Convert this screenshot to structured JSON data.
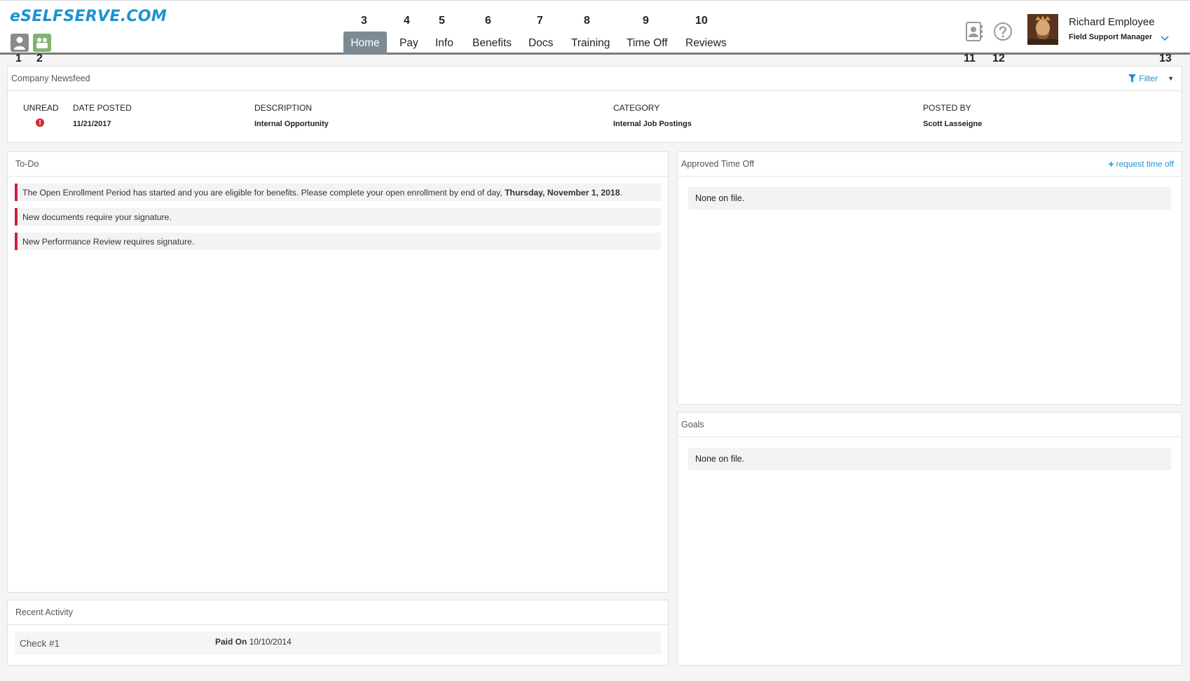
{
  "header": {
    "logo": "eSELFSERVE.COM",
    "nav": [
      {
        "label": "Home",
        "num": "3"
      },
      {
        "label": "Pay",
        "num": "4"
      },
      {
        "label": "Info",
        "num": "5"
      },
      {
        "label": "Benefits",
        "num": "6"
      },
      {
        "label": "Docs",
        "num": "7"
      },
      {
        "label": "Training",
        "num": "8"
      },
      {
        "label": "Time Off",
        "num": "9"
      },
      {
        "label": "Reviews",
        "num": "10"
      }
    ],
    "user": {
      "name": "Richard Employee",
      "title": "Field Support Manager"
    },
    "markers": {
      "m1": "1",
      "m2": "2",
      "m11": "11",
      "m12": "12",
      "m13": "13"
    }
  },
  "newsfeed": {
    "title": "Company Newsfeed",
    "filter": "Filter",
    "columns": {
      "unread": "UNREAD",
      "date": "DATE POSTED",
      "description": "DESCRIPTION",
      "category": "CATEGORY",
      "posted_by": "POSTED BY"
    },
    "row": {
      "unread_icon": "!",
      "date": "11/21/2017",
      "description": "Internal Opportunity",
      "category": "Internal Job Postings",
      "posted_by": "Scott Lasseigne"
    }
  },
  "todo": {
    "title": "To-Do",
    "items": [
      {
        "text": "The Open Enrollment Period has started and you are eligible for benefits. Please complete your open enrollment by end of day,",
        "bold": "Thursday, November 1, 2018",
        "suffix": "."
      },
      {
        "text": "New documents require your signature."
      },
      {
        "text": "New Performance Review requires signature."
      }
    ]
  },
  "time_off": {
    "title": "Approved Time Off",
    "link": "request time off",
    "empty": "None on file."
  },
  "goals": {
    "title": "Goals",
    "empty": "None on file."
  },
  "recent_activity": {
    "title": "Recent Activity",
    "row": {
      "check": "Check #1",
      "paid_label": "Paid On",
      "paid_date": "10/10/2014"
    }
  },
  "colors": {
    "brand": "#1c93cf",
    "nav_active": "#7d8a93",
    "todo_accent": "#c8243d",
    "unread_red": "#d7262e"
  }
}
